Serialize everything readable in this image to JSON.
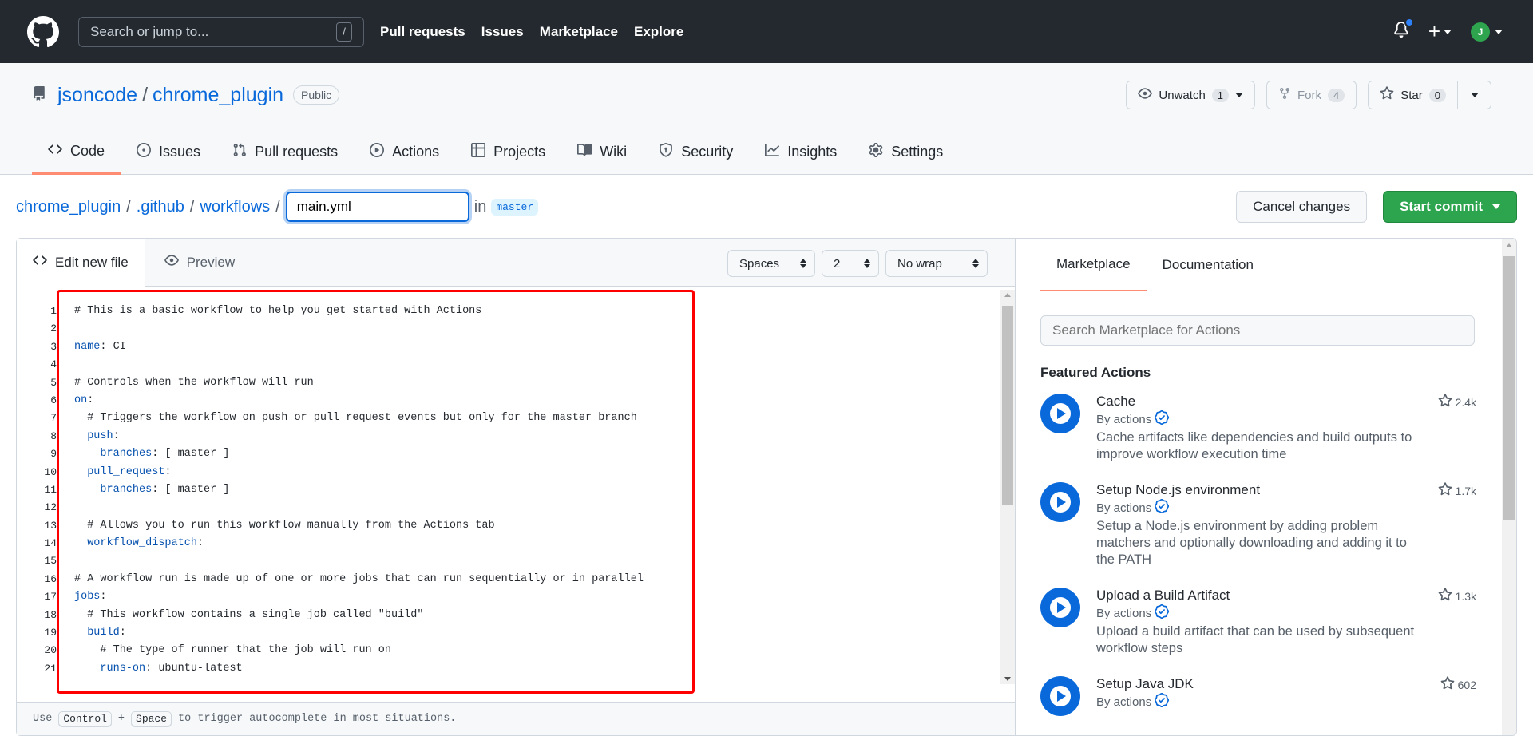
{
  "header": {
    "search_placeholder": "Search or jump to...",
    "slash_key": "/",
    "nav": [
      "Pull requests",
      "Issues",
      "Marketplace",
      "Explore"
    ],
    "plus": "+",
    "avatar_initials": "J"
  },
  "repo": {
    "owner": "jsoncode",
    "name": "chrome_plugin",
    "visibility": "Public",
    "unwatch_label": "Unwatch",
    "watch_count": "1",
    "fork_label": "Fork",
    "fork_count": "4",
    "star_label": "Star",
    "star_count": "0"
  },
  "tabs": [
    {
      "label": "Code",
      "icon": "code-icon"
    },
    {
      "label": "Issues",
      "icon": "issue-icon"
    },
    {
      "label": "Pull requests",
      "icon": "pull-request-icon"
    },
    {
      "label": "Actions",
      "icon": "play-icon"
    },
    {
      "label": "Projects",
      "icon": "table-icon"
    },
    {
      "label": "Wiki",
      "icon": "book-icon"
    },
    {
      "label": "Security",
      "icon": "shield-icon"
    },
    {
      "label": "Insights",
      "icon": "graph-icon"
    },
    {
      "label": "Settings",
      "icon": "gear-icon"
    }
  ],
  "breadcrumb": {
    "root": "chrome_plugin",
    "dir1": ".github",
    "dir2": "workflows",
    "sep": "/",
    "filename": "main.yml",
    "in_label": "in",
    "branch": "master"
  },
  "actions": {
    "cancel": "Cancel changes",
    "commit": "Start commit"
  },
  "editor": {
    "edit_tab": "Edit new file",
    "preview_tab": "Preview",
    "indent_mode": "Spaces",
    "indent_size": "2",
    "wrap_mode": "No wrap",
    "footer_use": "Use",
    "footer_key1": "Control",
    "footer_plus": "+",
    "footer_key2": "Space",
    "footer_rest": "to trigger autocomplete in most situations.",
    "line_numbers": [
      "1",
      "2",
      "3",
      "4",
      "5",
      "6",
      "7",
      "8",
      "9",
      "10",
      "11",
      "12",
      "13",
      "14",
      "15",
      "16",
      "17",
      "18",
      "19",
      "20",
      "21"
    ],
    "lines": [
      "# This is a basic workflow to help you get started with Actions",
      "",
      "name: CI",
      "",
      "# Controls when the workflow will run",
      "on:",
      "  # Triggers the workflow on push or pull request events but only for the master branch",
      "  push:",
      "    branches: [ master ]",
      "  pull_request:",
      "    branches: [ master ]",
      "",
      "  # Allows you to run this workflow manually from the Actions tab",
      "  workflow_dispatch:",
      "",
      "# A workflow run is made up of one or more jobs that can run sequentially or in parallel",
      "jobs:",
      "  # This workflow contains a single job called \"build\"",
      "  build:",
      "    # The type of runner that the job will run on",
      "    runs-on: ubuntu-latest"
    ]
  },
  "marketplace": {
    "tab_marketplace": "Marketplace",
    "tab_docs": "Documentation",
    "search_placeholder": "Search Marketplace for Actions",
    "featured_heading": "Featured Actions",
    "items": [
      {
        "name": "Cache",
        "by": "By actions",
        "desc": "Cache artifacts like dependencies and build outputs to improve workflow execution time",
        "stars": "2.4k"
      },
      {
        "name": "Setup Node.js environment",
        "by": "By actions",
        "desc": "Setup a Node.js environment by adding problem matchers and optionally downloading and adding it to the PATH",
        "stars": "1.7k"
      },
      {
        "name": "Upload a Build Artifact",
        "by": "By actions",
        "desc": "Upload a build artifact that can be used by subsequent workflow steps",
        "stars": "1.3k"
      },
      {
        "name": "Setup Java JDK",
        "by": "By actions",
        "desc": "",
        "stars": "602"
      }
    ]
  },
  "colors": {
    "header_bg": "#24292f",
    "link": "#0969da",
    "commit_green": "#2da44e",
    "highlight_box": "#ff0000",
    "tab_underline": "#fd8c73"
  }
}
